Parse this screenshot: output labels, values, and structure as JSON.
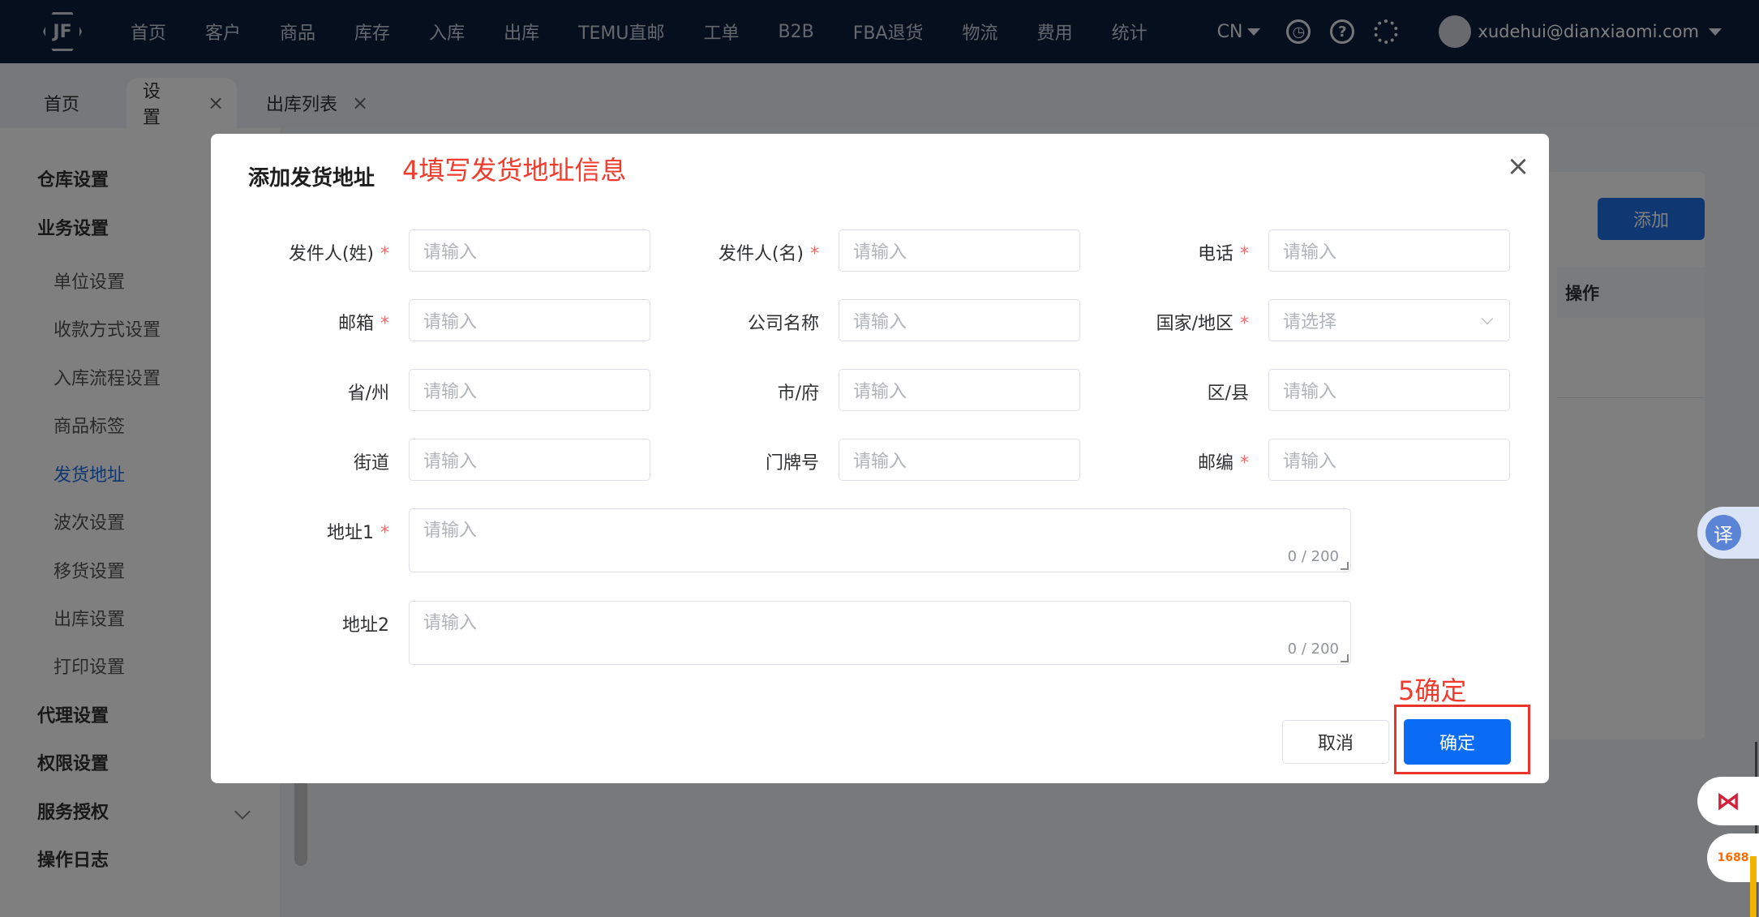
{
  "topnav": {
    "items": [
      "首页",
      "客户",
      "商品",
      "库存",
      "入库",
      "出库",
      "TEMU直邮",
      "工单",
      "B2B",
      "FBA退货",
      "物流",
      "费用",
      "统计"
    ],
    "lang": "CN",
    "user": "xudehui@dianxiaomi.com",
    "icons": [
      "clock-icon",
      "help-icon",
      "gear-icon"
    ]
  },
  "tabs": [
    {
      "label": "首页"
    },
    {
      "label": "设置",
      "closable": true
    },
    {
      "label": "出库列表",
      "closable": true
    }
  ],
  "sidebar": {
    "items": [
      {
        "label": "仓库设置",
        "kind": "group"
      },
      {
        "label": "业务设置",
        "kind": "group"
      },
      {
        "label": "单位设置",
        "kind": "sub"
      },
      {
        "label": "收款方式设置",
        "kind": "sub"
      },
      {
        "label": "入库流程设置",
        "kind": "sub"
      },
      {
        "label": "商品标签",
        "kind": "sub"
      },
      {
        "label": "发货地址",
        "kind": "sub",
        "active": true
      },
      {
        "label": "波次设置",
        "kind": "sub"
      },
      {
        "label": "移货设置",
        "kind": "sub"
      },
      {
        "label": "出库设置",
        "kind": "sub"
      },
      {
        "label": "打印设置",
        "kind": "sub"
      },
      {
        "label": "代理设置",
        "kind": "group"
      },
      {
        "label": "权限设置",
        "kind": "group"
      },
      {
        "label": "服务授权",
        "kind": "group"
      },
      {
        "label": "操作日志",
        "kind": "group"
      }
    ]
  },
  "main": {
    "add_button": "添加",
    "column_op": "操作"
  },
  "dialog": {
    "title": "添加发货地址",
    "annotation_step4": "4填写发货地址信息",
    "annotation_step5": "5确定",
    "close": "×",
    "fields": {
      "last_name": {
        "label": "发件人(姓)",
        "placeholder": "请输入",
        "required": true
      },
      "first_name": {
        "label": "发件人(名)",
        "placeholder": "请输入",
        "required": true
      },
      "phone": {
        "label": "电话",
        "placeholder": "请输入",
        "required": true
      },
      "email": {
        "label": "邮箱",
        "placeholder": "请输入",
        "required": true
      },
      "company": {
        "label": "公司名称",
        "placeholder": "请输入"
      },
      "country": {
        "label": "国家/地区",
        "placeholder": "请选择",
        "required": true
      },
      "province": {
        "label": "省/州",
        "placeholder": "请输入"
      },
      "city": {
        "label": "市/府",
        "placeholder": "请输入"
      },
      "district": {
        "label": "区/县",
        "placeholder": "请输入"
      },
      "street": {
        "label": "街道",
        "placeholder": "请输入"
      },
      "house_no": {
        "label": "门牌号",
        "placeholder": "请输入"
      },
      "zip": {
        "label": "邮编",
        "placeholder": "请输入",
        "required": true
      },
      "address1": {
        "label": "地址1",
        "placeholder": "请输入",
        "required": true,
        "count": "0 / 200"
      },
      "address2": {
        "label": "地址2",
        "placeholder": "请输入",
        "count": "0 / 200"
      }
    },
    "cancel": "取消",
    "confirm": "确定",
    "required_mark": "*"
  },
  "widgets": {
    "translate": "译",
    "icon_1688": "1688"
  },
  "colors": {
    "nav_bg": "#0b1f3a",
    "primary": "#0a6cf5",
    "annotation": "#f03c2e",
    "required": "#f56c6c"
  }
}
